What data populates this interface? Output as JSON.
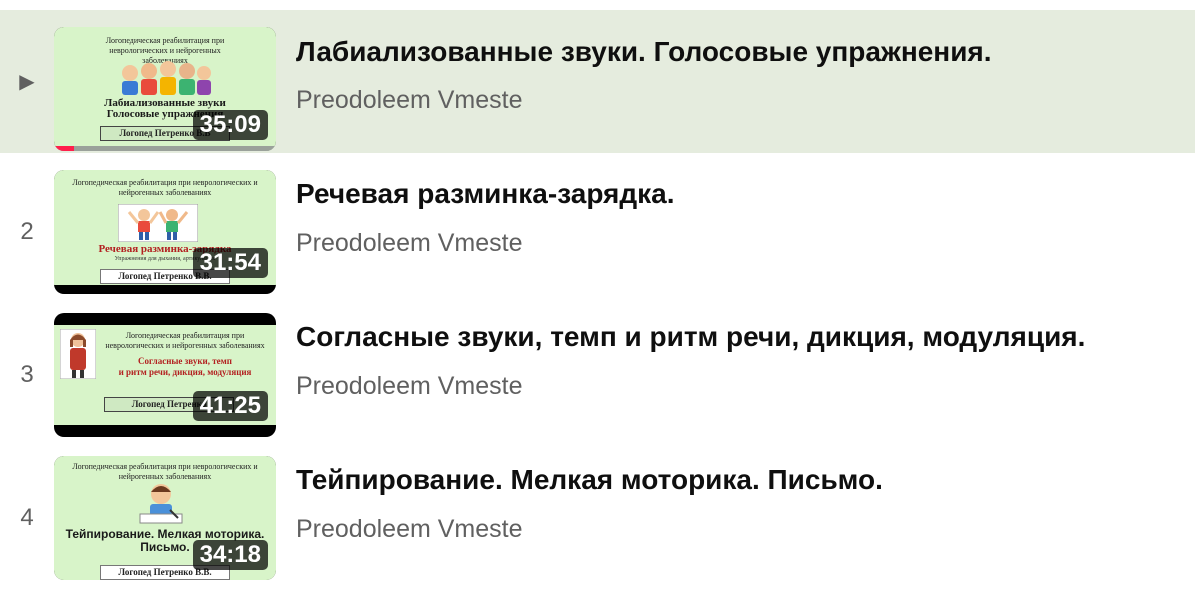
{
  "colors": {
    "active_row_background": "#e5ecde",
    "progress_red": "#ff1f4b",
    "channel_gray": "#606060"
  },
  "playlist": [
    {
      "index_icon": "play-icon",
      "index_symbol": "▶",
      "title": "Лабиализованные звуки. Голосовые упражнения.",
      "channel": "Preodoleem Vmeste",
      "duration": "35:09",
      "active": true,
      "watch_progress": 0.09,
      "thumbnail": {
        "header": "Логопедическая реабилитация при неврологических и нейрогенных заболеваниях",
        "title_line1": "Лабиализованные звуки",
        "title_line2": "Голосовые упражнения",
        "author": "Логопед Петренко В.В"
      }
    },
    {
      "index": "2",
      "title": "Речевая разминка-зарядка.",
      "channel": "Preodoleem Vmeste",
      "duration": "31:54",
      "thumbnail": {
        "header": "Логопедическая реабилитация при неврологических и нейрогенных заболеваниях",
        "title_line1": "Речевая разминка-зарядка",
        "subtitle": "Упражнения для дыхания, артикуляции",
        "author": "Логопед Петренко В.В."
      }
    },
    {
      "index": "3",
      "title": "Согласные звуки, темп и ритм речи, дикция, модуляция.",
      "channel": "Preodoleem Vmeste",
      "duration": "41:25",
      "thumbnail": {
        "header": "Логопедическая реабилитация при неврологических и нейрогенных заболеваниях",
        "title_line1": "Согласные звуки, темп",
        "title_line2": "и ритм речи, дикция, модуляция",
        "author": "Логопед Петренко"
      }
    },
    {
      "index": "4",
      "title": "Тейпирование. Мелкая моторика. Письмо.",
      "channel": "Preodoleem Vmeste",
      "duration": "34:18",
      "thumbnail": {
        "header": "Логопедическая реабилитация при неврологических и нейрогенных заболеваниях",
        "title_line1": "Тейпирование. Мелкая моторика.",
        "title_line2": "Письмо.",
        "author": "Логопед Петренко В.В."
      }
    }
  ]
}
